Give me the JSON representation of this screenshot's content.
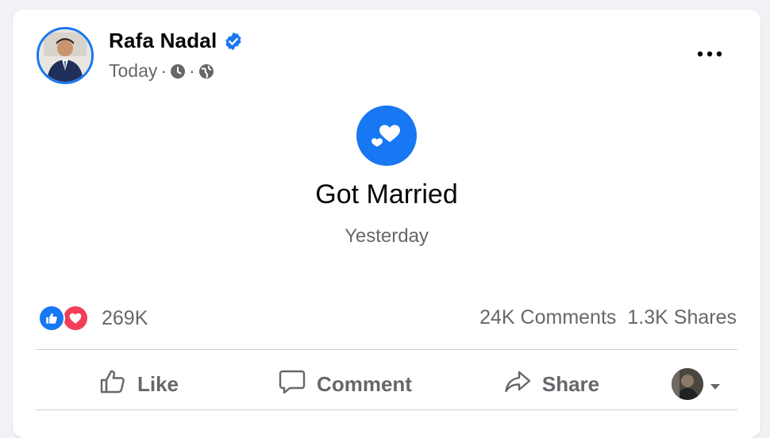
{
  "post": {
    "author": "Rafa Nadal",
    "timestamp": "Today",
    "separator": "·",
    "icons": {
      "verified": "verified-badge-icon",
      "clock": "clock-icon",
      "audience": "globe-icon",
      "more": "more-options-icon",
      "life_event": "hearts-icon"
    },
    "life_event": {
      "title": "Got Married",
      "date": "Yesterday"
    }
  },
  "engagement": {
    "reaction_count": "269K",
    "comments": "24K Comments",
    "shares": "1.3K Shares"
  },
  "actions": {
    "like": "Like",
    "comment": "Comment",
    "share": "Share"
  },
  "colors": {
    "accent": "#1877f2",
    "love": "#f33e58",
    "secondary_text": "#65676b"
  }
}
